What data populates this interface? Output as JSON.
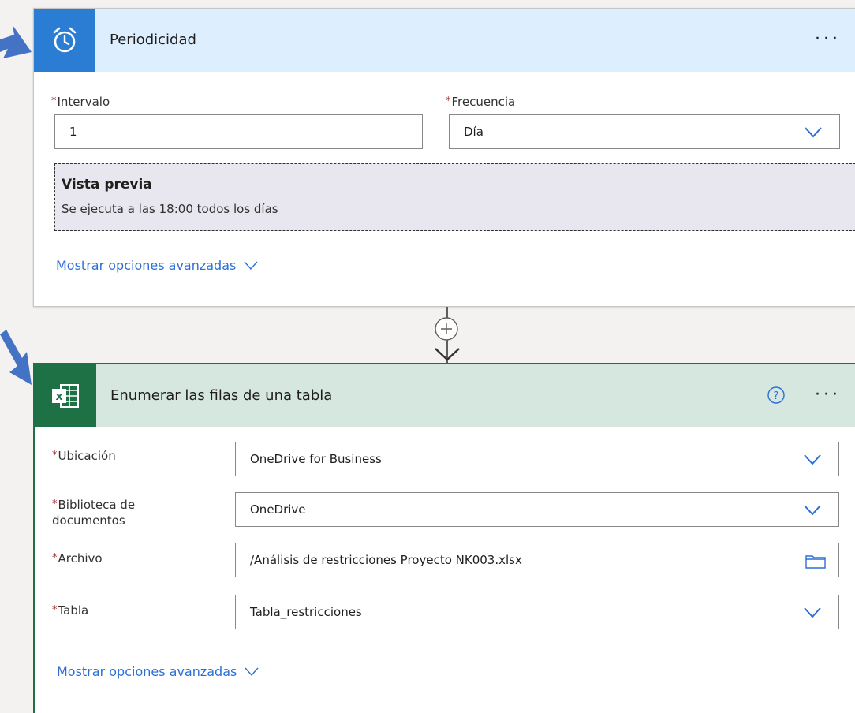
{
  "trigger": {
    "title": "Periodicidad",
    "more_label": "···",
    "interval_label": "Intervalo",
    "interval_value": "1",
    "frequency_label": "Frecuencia",
    "frequency_value": "Día",
    "preview_title": "Vista previa",
    "preview_text": "Se ejecuta a las 18:00 todos los días",
    "advanced_label": "Mostrar opciones avanzadas",
    "required_mark": "*",
    "icon": "alarm-clock-icon",
    "accent_color": "#2b7cd3"
  },
  "action": {
    "title": "Enumerar las filas de una tabla",
    "more_label": "···",
    "help_icon": "help-icon",
    "icon": "excel-icon",
    "accent_color": "#1e7145",
    "required_mark": "*",
    "fields": {
      "location_label": "Ubicación",
      "location_value": "OneDrive for Business",
      "library_label_line1": "Biblioteca de",
      "library_label_line2": "documentos",
      "library_value": "OneDrive",
      "file_label": "Archivo",
      "file_value": "/Análisis de restricciones Proyecto NK003.xlsx",
      "table_label": "Tabla",
      "table_value": "Tabla_restricciones"
    },
    "advanced_label": "Mostrar opciones avanzadas"
  },
  "colors": {
    "link": "#2b6fd6",
    "required": "#a4262c",
    "annotation_arrow": "#4472c4"
  }
}
